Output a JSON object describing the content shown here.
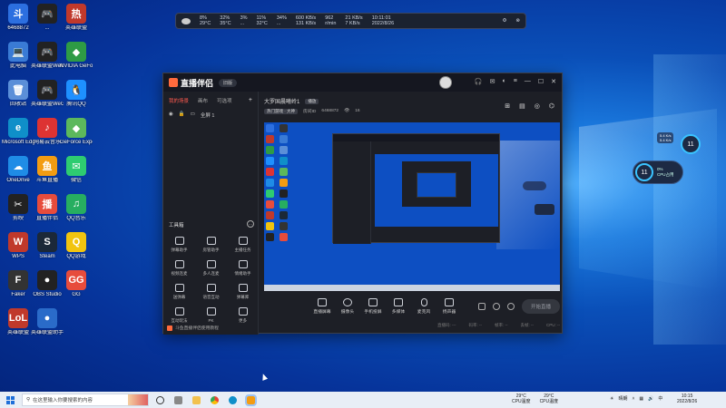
{
  "desktop": {
    "icons": [
      {
        "label": "6468872",
        "color": "#2c6fe0",
        "glyph": "斗"
      },
      {
        "label": "...",
        "color": "#222",
        "glyph": "🎮"
      },
      {
        "label": "英雄联盟",
        "color": "#c0392b",
        "glyph": "热"
      },
      {
        "label": "此电脑",
        "color": "#3a7bd5",
        "glyph": "💻"
      },
      {
        "label": "英雄联盟WeGame版",
        "color": "#222",
        "glyph": "🎮"
      },
      {
        "label": "NVIDIA GeForce",
        "color": "#2e9b45",
        "glyph": "◆"
      },
      {
        "label": "回收站",
        "color": "#5b8fd8",
        "glyph": "🗑"
      },
      {
        "label": "英雄联盟WeGame版",
        "color": "#222",
        "glyph": "🎮"
      },
      {
        "label": "腾讯QQ",
        "color": "#1e90ff",
        "glyph": "🐧"
      },
      {
        "label": "Microsoft Edge",
        "color": "#0f8fc9",
        "glyph": "e"
      },
      {
        "label": "网易云音乐",
        "color": "#d33",
        "glyph": "♪"
      },
      {
        "label": "GeForce Experience",
        "color": "#5cb85c",
        "glyph": "◆"
      },
      {
        "label": "OneDrive",
        "color": "#1f8ce6",
        "glyph": "☁"
      },
      {
        "label": "斗鱼直播",
        "color": "#f39c12",
        "glyph": "鱼"
      },
      {
        "label": "微信",
        "color": "#2ecc71",
        "glyph": "✉"
      },
      {
        "label": "剪映",
        "color": "#222",
        "glyph": "✂"
      },
      {
        "label": "直播伴侣",
        "color": "#e74c3c",
        "glyph": "播"
      },
      {
        "label": "QQ音乐",
        "color": "#27ae60",
        "glyph": "♫"
      },
      {
        "label": "WPS",
        "color": "#c0392b",
        "glyph": "W"
      },
      {
        "label": "Steam",
        "color": "#1b2838",
        "glyph": "S"
      },
      {
        "label": "QQ游戏",
        "color": "#f1c40f",
        "glyph": "Q"
      },
      {
        "label": "Faker",
        "color": "#333",
        "glyph": "F"
      },
      {
        "label": "OBS Studio",
        "color": "#222",
        "glyph": "●"
      },
      {
        "label": "GG",
        "color": "#e74c3c",
        "glyph": "GG"
      },
      {
        "label": "英雄联盟",
        "color": "#c0392b",
        "glyph": "LoL"
      },
      {
        "label": "英雄联盟助手",
        "color": "#2a6bc9",
        "glyph": "●"
      }
    ]
  },
  "monitor_bar": {
    "items": [
      {
        "top": "8%",
        "bottom": "29°C"
      },
      {
        "top": "32%",
        "bottom": "35°C"
      },
      {
        "top": "3%",
        "bottom": "..."
      },
      {
        "top": "11%",
        "bottom": "32°C"
      },
      {
        "top": "34%",
        "bottom": "..."
      },
      {
        "top": "600 KB/s",
        "bottom": "131 KB/s"
      },
      {
        "top": "962",
        "bottom": "r/min"
      },
      {
        "top": "21 KB/s",
        "bottom": "7 KB/s"
      },
      {
        "top": "10:11:01",
        "bottom": "2022/8/26"
      }
    ]
  },
  "app": {
    "title": "直播伴侣",
    "version": "旧版",
    "left_tabs": [
      "我的场景",
      "画布",
      "可选项"
    ],
    "scene_label": "全屏 1",
    "tools_title": "工具箱",
    "tools": [
      "弹幕助手",
      "房管助手",
      "主播任务",
      "视频连麦",
      "多人连麦",
      "情绪助手",
      "送弹幕",
      "语音互动",
      "弹幕库",
      "互动玩法",
      "PK",
      "更多"
    ],
    "notice": "斗鱼直播伴侣使用教程",
    "room_title": "大罗国晨曦岭1",
    "room_tag": "播放",
    "category": "热门游戏 · 大神",
    "room_id_label": "房间ID",
    "room_id": "6468872",
    "room_count": "16",
    "controls": [
      "直播屏幕",
      "摄像头",
      "手机投屏",
      "多媒体",
      "麦克风",
      "扬声器"
    ],
    "go_live": "开始直播",
    "status": [
      "直播码: ---",
      "码率: --",
      "帧率: --",
      "丢帧: --",
      "CPU: --"
    ]
  },
  "widgets": {
    "w1_ring": "11",
    "w1_bubble": [
      "5.4 K/s",
      "5.4 K/s"
    ],
    "w2_ring": "11",
    "w2_lines": [
      "0%",
      "CPU占用"
    ]
  },
  "taskbar": {
    "search_placeholder": "在这里输入你要搜索的内容",
    "cpu1_temp": "29°C",
    "cpu1_label": "CPU温度",
    "cpu2_temp": "29°C",
    "cpu2_label": "CPU温度",
    "weather": "晴朗",
    "lang": "中",
    "time": "10:15",
    "date": "2022/8/26"
  }
}
